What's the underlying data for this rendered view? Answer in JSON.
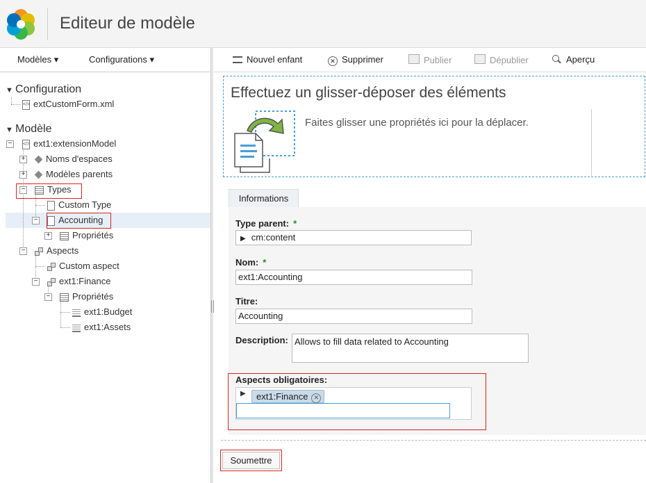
{
  "header": {
    "title": "Editeur de modèle",
    "logo_icon": "alfresco-logo"
  },
  "left_menu": {
    "models_label": "Modèles ▾",
    "configurations_label": "Configurations ▾"
  },
  "tree": {
    "configuration_title": "Configuration",
    "configuration_file": "extCustomForm.xml",
    "model_title": "Modèle",
    "nodes": {
      "extension_model": "ext1:extensionModel",
      "namespaces": "Noms d'espaces",
      "parent_models": "Modèles parents",
      "types": "Types",
      "custom_type": "Custom Type",
      "accounting": "Accounting",
      "accounting_props": "Propriétés",
      "aspects": "Aspects",
      "custom_aspect": "Custom aspect",
      "finance": "ext1:Finance",
      "finance_props": "Propriétés",
      "budget": "ext1:Budget",
      "assets": "ext1:Assets"
    }
  },
  "toolbar": {
    "new_child": "Nouvel enfant",
    "delete": "Supprimer",
    "publish": "Publier",
    "unpublish": "Dépublier",
    "preview": "Aperçu"
  },
  "dropzone": {
    "title": "Effectuez un glisser-déposer des éléments",
    "hint": "Faites glisser une propriétés ici pour la déplacer."
  },
  "form": {
    "tab_label": "Informations",
    "parent_type_label": "Type parent:",
    "parent_type_value": "cm:content",
    "name_label": "Nom:",
    "name_value": "ext1:Accounting",
    "title_label": "Titre:",
    "title_value": "Accounting",
    "description_label": "Description:",
    "description_value": "Allows to fill data related to Accounting",
    "mandatory_aspects_label": "Aspects obligatoires:",
    "mandatory_aspect_chip": "ext1:Finance",
    "required_marker": "*",
    "submit_label": "Soumettre"
  },
  "colors": {
    "highlight_red": "#dd2222",
    "accent_blue": "#4a9cd6",
    "selection_bg": "#e6eef7"
  }
}
